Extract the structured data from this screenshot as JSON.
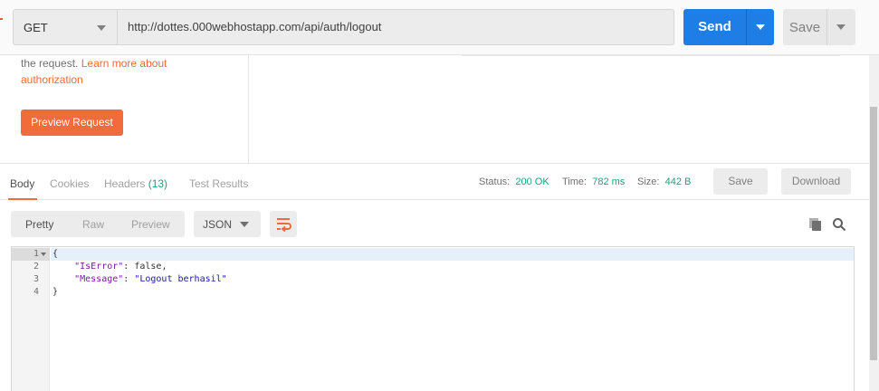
{
  "request": {
    "method": "GET",
    "url": "http://dottes.000webhostapp.com/api/auth/logout",
    "send_label": "Send",
    "save_label": "Save"
  },
  "auth": {
    "help_text": "the request.",
    "learn_more_line1": "Learn more about",
    "learn_more_line2": "authorization",
    "preview_label": "Preview Request"
  },
  "response": {
    "tabs": [
      {
        "label": "Body"
      },
      {
        "label": "Cookies"
      },
      {
        "label": "Headers",
        "count": "(13)"
      },
      {
        "label": "Test Results"
      }
    ],
    "status_label": "Status:",
    "status_value": "200 OK",
    "time_label": "Time:",
    "time_value": "782 ms",
    "size_label": "Size:",
    "size_value": "442 B",
    "save_label": "Save",
    "download_label": "Download"
  },
  "body_toolbar": {
    "formats": [
      "Pretty",
      "Raw",
      "Preview"
    ],
    "language": "JSON"
  },
  "code": {
    "line_numbers": [
      "1",
      "2",
      "3",
      "4"
    ],
    "open_brace": "{",
    "close_brace": "}",
    "key1": "\"IsError\"",
    "val1": "false",
    "key2": "\"Message\"",
    "val2": "\"Logout berhasil\""
  },
  "colors": {
    "accent": "#f26b3a",
    "send": "#1e7ee6",
    "status_green": "#1fa27b"
  }
}
